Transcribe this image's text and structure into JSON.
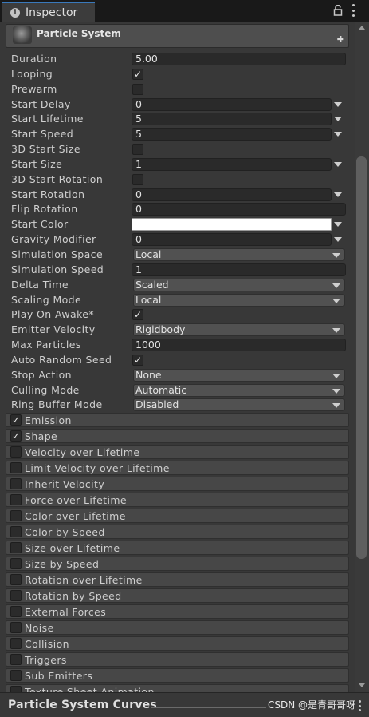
{
  "tab": {
    "title": "Inspector",
    "info_icon": "info-icon",
    "lock_icon": "lock-icon",
    "menu_icon": "kebab-menu-icon"
  },
  "component": {
    "title": "Particle System",
    "icon": "particle-system-icon",
    "add_icon": "plus-icon"
  },
  "properties": [
    {
      "label": "Duration",
      "type": "field",
      "value": "5.00",
      "width": "full"
    },
    {
      "label": "Looping",
      "type": "checkbox",
      "checked": true
    },
    {
      "label": "Prewarm",
      "type": "checkbox",
      "checked": false
    },
    {
      "label": "Start Delay",
      "type": "field",
      "value": "0",
      "width": "short",
      "arrow": true
    },
    {
      "label": "Start Lifetime",
      "type": "field",
      "value": "5",
      "width": "short",
      "arrow": true
    },
    {
      "label": "Start Speed",
      "type": "field",
      "value": "5",
      "width": "short",
      "arrow": true
    },
    {
      "label": "3D Start Size",
      "type": "checkbox",
      "checked": false
    },
    {
      "label": "Start Size",
      "type": "field",
      "value": "1",
      "width": "short",
      "arrow": true
    },
    {
      "label": "3D Start Rotation",
      "type": "checkbox",
      "checked": false
    },
    {
      "label": "Start Rotation",
      "type": "field",
      "value": "0",
      "width": "short",
      "arrow": true
    },
    {
      "label": "Flip Rotation",
      "type": "field",
      "value": "0",
      "width": "full"
    },
    {
      "label": "Start Color",
      "type": "color",
      "value": "#ffffff",
      "arrow": true
    },
    {
      "label": "Gravity Modifier",
      "type": "field",
      "value": "0",
      "width": "short",
      "arrow": true
    },
    {
      "label": "Simulation Space",
      "type": "dropdown",
      "value": "Local"
    },
    {
      "label": "Simulation Speed",
      "type": "field",
      "value": "1",
      "width": "full"
    },
    {
      "label": "Delta Time",
      "type": "dropdown",
      "value": "Scaled"
    },
    {
      "label": "Scaling Mode",
      "type": "dropdown",
      "value": "Local"
    },
    {
      "label": "Play On Awake*",
      "type": "checkbox",
      "checked": true
    },
    {
      "label": "Emitter Velocity",
      "type": "dropdown",
      "value": "Rigidbody"
    },
    {
      "label": "Max Particles",
      "type": "field",
      "value": "1000",
      "width": "full"
    },
    {
      "label": "Auto Random Seed",
      "type": "checkbox",
      "checked": true
    },
    {
      "label": "Stop Action",
      "type": "dropdown",
      "value": "None"
    },
    {
      "label": "Culling Mode",
      "type": "dropdown",
      "value": "Automatic"
    },
    {
      "label": "Ring Buffer Mode",
      "type": "dropdown",
      "value": "Disabled"
    }
  ],
  "modules": [
    {
      "label": "Emission",
      "checked": true
    },
    {
      "label": "Shape",
      "checked": true
    },
    {
      "label": "Velocity over Lifetime",
      "checked": false
    },
    {
      "label": "Limit Velocity over Lifetime",
      "checked": false
    },
    {
      "label": "Inherit Velocity",
      "checked": false
    },
    {
      "label": "Force over Lifetime",
      "checked": false
    },
    {
      "label": "Color over Lifetime",
      "checked": false
    },
    {
      "label": "Color by Speed",
      "checked": false
    },
    {
      "label": "Size over Lifetime",
      "checked": false
    },
    {
      "label": "Size by Speed",
      "checked": false
    },
    {
      "label": "Rotation over Lifetime",
      "checked": false
    },
    {
      "label": "Rotation by Speed",
      "checked": false
    },
    {
      "label": "External Forces",
      "checked": false
    },
    {
      "label": "Noise",
      "checked": false
    },
    {
      "label": "Collision",
      "checked": false
    },
    {
      "label": "Triggers",
      "checked": false
    },
    {
      "label": "Sub Emitters",
      "checked": false
    },
    {
      "label": "Texture Sheet Animation",
      "checked": false
    }
  ],
  "bottom": {
    "title": "Particle System Curves",
    "watermark": "CSDN @是青哥哥呀",
    "menu_icon": "kebab-menu-icon"
  },
  "colors": {
    "background": "#383838",
    "tab_accent": "#3a79bb",
    "field_bg": "#2a2a2a",
    "dropdown_bg": "#515151"
  }
}
